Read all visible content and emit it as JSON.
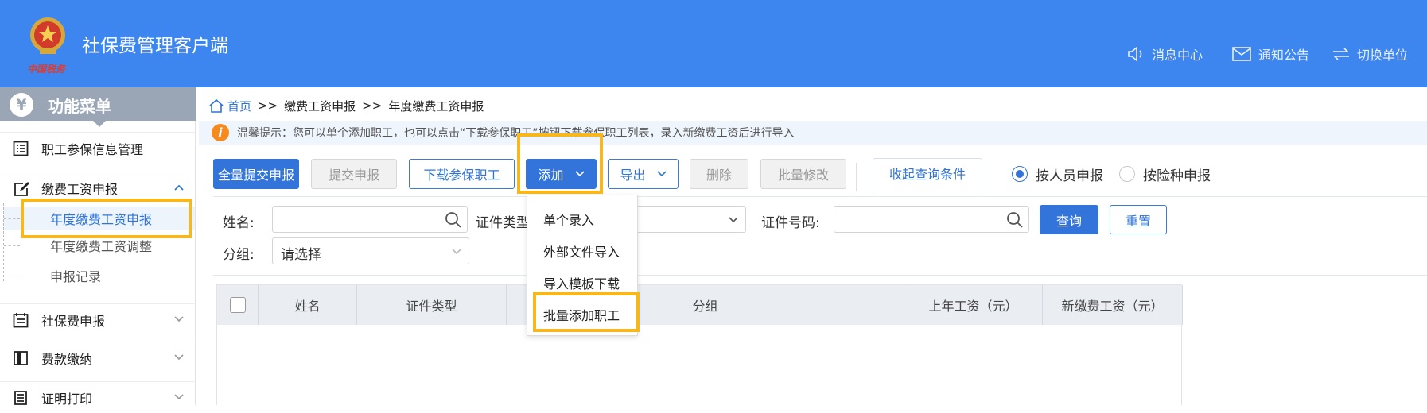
{
  "header": {
    "title": "社保费管理客户端",
    "brand_script": "中国税务",
    "nav": [
      {
        "label": "消息中心",
        "icon": "speaker-icon"
      },
      {
        "label": "通知公告",
        "icon": "mail-icon"
      },
      {
        "label": "切换单位",
        "icon": "switch-icon"
      }
    ],
    "bg_color": "#3d86ef"
  },
  "sidebar": {
    "title": "功能菜单",
    "items": [
      {
        "label": "职工参保信息管理",
        "icon": "list-icon"
      },
      {
        "label": "缴费工资申报",
        "icon": "edit-icon",
        "expanded": true,
        "children": [
          {
            "label": "年度缴费工资申报",
            "active": true
          },
          {
            "label": "年度缴费工资调整"
          },
          {
            "label": "申报记录"
          }
        ]
      },
      {
        "label": "社保费申报",
        "icon": "calendar-icon"
      },
      {
        "label": "费款缴纳",
        "icon": "book-icon"
      },
      {
        "label": "证明打印",
        "icon": "print-list-icon"
      }
    ]
  },
  "breadcrumb": {
    "home": "首页",
    "separator": ">>",
    "level1": "缴费工资申报",
    "level2": "年度缴费工资申报"
  },
  "notice": {
    "text": "温馨提示：您可以单个添加职工，也可以点击“下载参保职工”按钮下载参保职工列表，录入新缴费工资后进行导入"
  },
  "toolbar": {
    "submit_all": "全量提交申报",
    "submit": "提交申报",
    "download_staff": "下载参保职工",
    "add": "添加",
    "export": "导出",
    "delete": "删除",
    "batch_edit": "批量修改",
    "collapse_query": "收起查询条件",
    "radio_by_person": "按人员申报",
    "radio_by_type": "按险种申报"
  },
  "filters": {
    "name_label": "姓名:",
    "id_type_label": "证件类型",
    "id_no_label": "证件号码:",
    "group_label": "分组:",
    "group_value": "请选择",
    "query": "查询",
    "reset": "重置"
  },
  "add_menu": {
    "items": [
      "单个录入",
      "外部文件导入",
      "导入模板下载",
      "批量添加职工"
    ]
  },
  "table": {
    "columns": [
      "姓名",
      "证件类型",
      "分组",
      "上年工资（元）",
      "新缴费工资（元）"
    ]
  },
  "colors": {
    "accent": "#3274d9",
    "highlight": "#f8b81c",
    "warning": "#f58a1f"
  }
}
